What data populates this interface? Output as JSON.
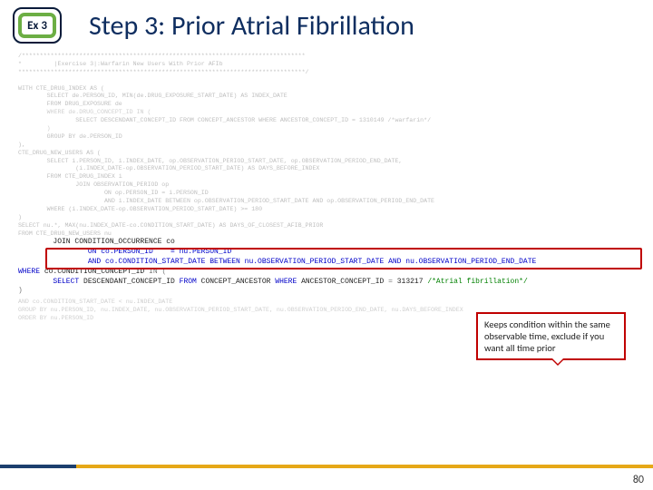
{
  "badge": {
    "label": "Ex 3"
  },
  "title": "Step 3: Prior Atrial Fibrillation",
  "callout": "Keeps condition within the same observable time, exclude if you want all time prior",
  "code": {
    "c01": "/*******************************************************************************",
    "c02": "*         |Exercise 3|:Warfarin New Users With Prior AFIb",
    "c03": "********************************************************************************/",
    "c04": "",
    "c05": "WITH CTE_DRUG_INDEX AS (",
    "c06": "        SELECT de.PERSON_ID, MIN(de.DRUG_EXPOSURE_START_DATE) AS INDEX_DATE",
    "c07": "        FROM DRUG_EXPOSURE de",
    "c08": "        WHERE de.DRUG_CONCEPT_ID IN (",
    "c09": "                SELECT DESCENDANT_CONCEPT_ID FROM CONCEPT_ANCESTOR WHERE ANCESTOR_CONCEPT_ID = 1310149 /*warfarin*/",
    "c10": "        )",
    "c11": "        GROUP BY de.PERSON_ID",
    "c12": "),",
    "c13": "CTE_DRUG_NEW_USERS AS (",
    "c14": "        SELECT i.PERSON_ID, i.INDEX_DATE, op.OBSERVATION_PERIOD_START_DATE, op.OBSERVATION_PERIOD_END_DATE,",
    "c15": "                (i.INDEX_DATE-op.OBSERVATION_PERIOD_START_DATE) AS DAYS_BEFORE_INDEX",
    "c16": "        FROM CTE_DRUG_INDEX i",
    "c17": "                JOIN OBSERVATION_PERIOD op",
    "c18": "                        ON op.PERSON_ID = i.PERSON_ID",
    "c19": "                        AND i.INDEX_DATE BETWEEN op.OBSERVATION_PERIOD_START_DATE AND op.OBSERVATION_PERIOD_END_DATE",
    "c20": "        WHERE (i.INDEX_DATE-op.OBSERVATION_PERIOD_START_DATE) >= 180",
    "c21": ")",
    "c22": "SELECT nu.*, MAX(nu.INDEX_DATE-co.CONDITION_START_DATE) AS DAYS_OF_CLOSEST_AFIB_PRIOR",
    "c23": "FROM CTE_DRUG_NEW_USERS nu",
    "h1a": "        JOIN CONDITION_OCCURRENCE co",
    "h1b": "                ON co.PERSON_ID    = nu.PERSON_ID",
    "h1c": "                AND co.CONDITION_START_DATE BETWEEN nu.OBSERVATION_PERIOD_START_DATE AND nu.OBSERVATION_PERIOD_END_DATE",
    "w1a": "WHERE",
    "w1b": " co.CONDITION_CONCEPT_ID ",
    "w1c": "IN ",
    "w1d": "(",
    "w2a": "        SELECT",
    "w2b": " DESCENDANT_CONCEPT_ID ",
    "w2c": "FROM",
    "w2d": " CONCEPT_ANCESTOR ",
    "w2e": "WHERE",
    "w2f": " ANCESTOR_CONCEPT_ID ",
    "w2g": "=",
    "w2h": " 313217 ",
    "w2i": "/*Atrial fibrillation*/",
    "w3": ")",
    "t1": "AND co.CONDITION_START_DATE < nu.INDEX_DATE",
    "t2": "GROUP BY nu.PERSON_ID, nu.INDEX_DATE, nu.OBSERVATION_PERIOD_START_DATE, nu.OBSERVATION_PERIOD_END_DATE, nu.DAYS_BEFORE_INDEX",
    "t3": "ORDER BY nu.PERSON_ID"
  },
  "page": "80"
}
